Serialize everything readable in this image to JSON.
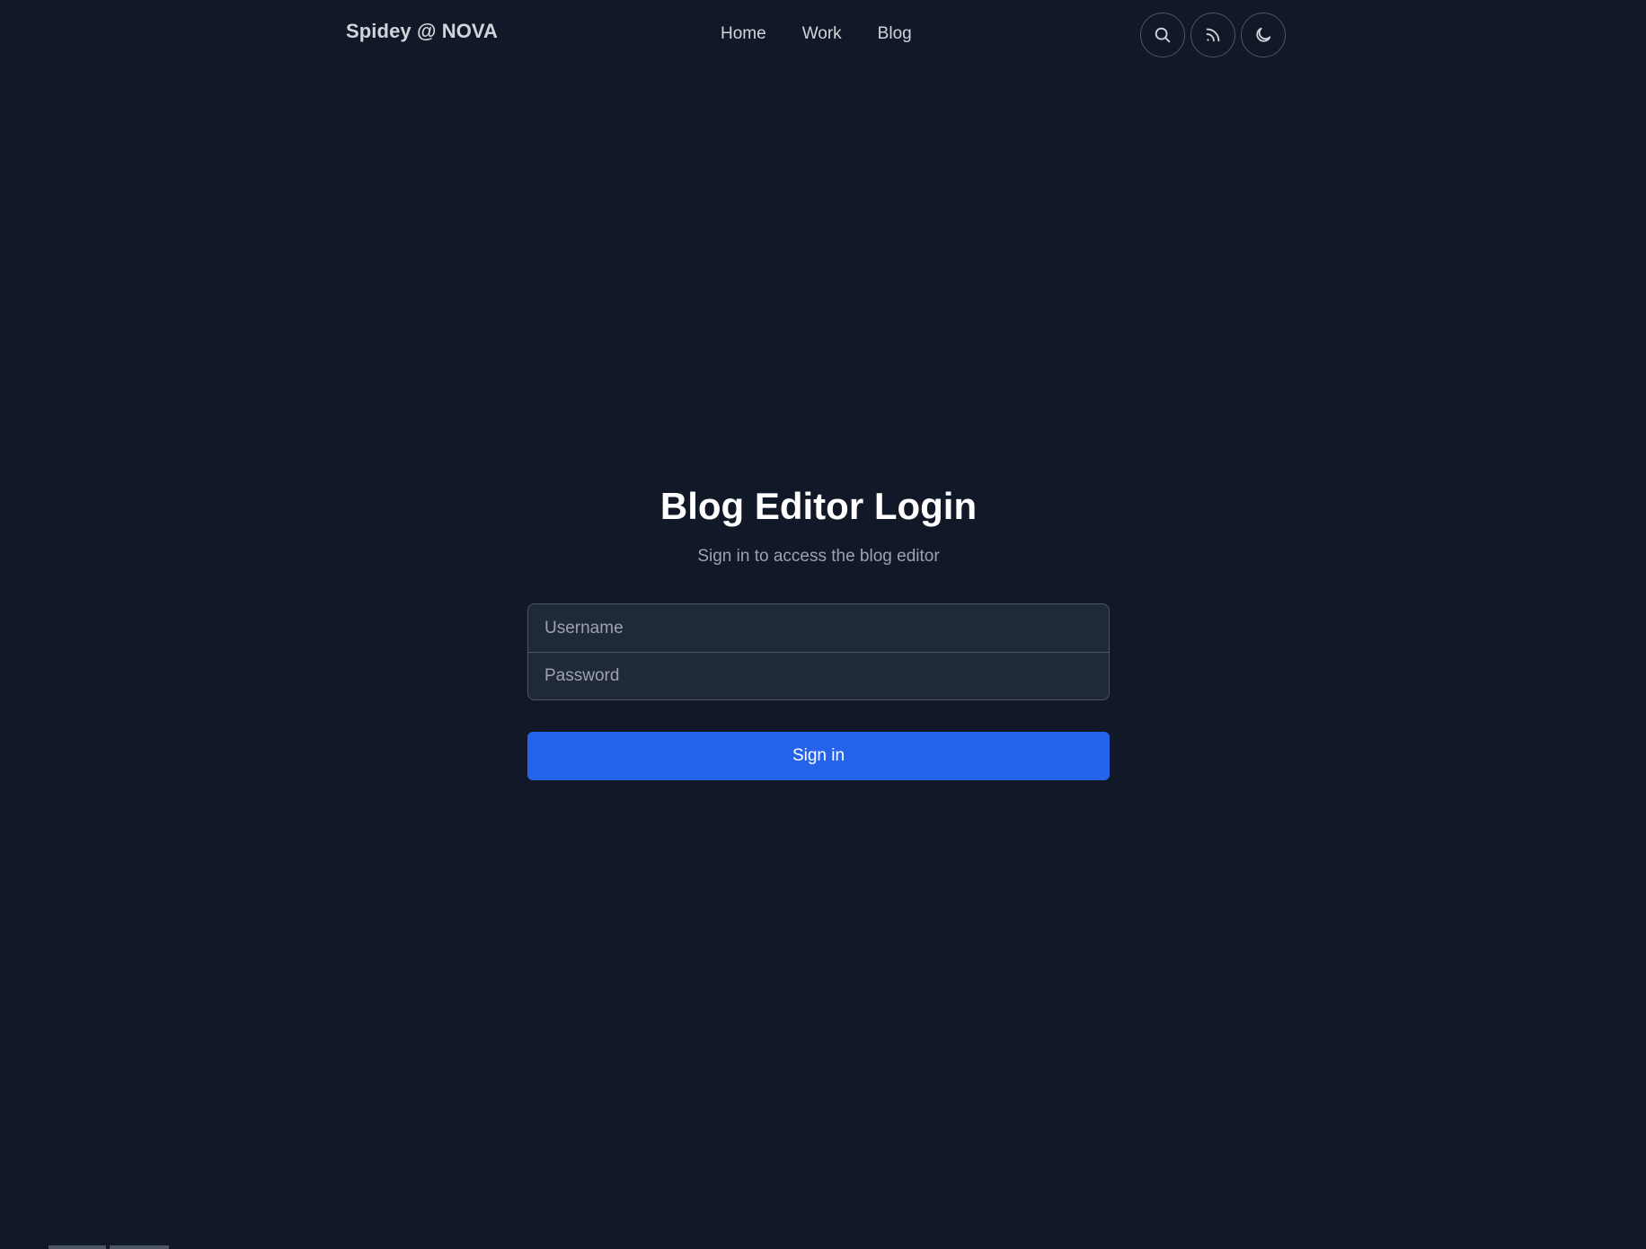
{
  "header": {
    "brand": "Spidey @ NOVA",
    "nav": [
      {
        "label": "Home"
      },
      {
        "label": "Work"
      },
      {
        "label": "Blog"
      }
    ],
    "icons": [
      "search-icon",
      "rss-icon",
      "moon-icon"
    ]
  },
  "login": {
    "title": "Blog Editor Login",
    "subtitle": "Sign in to access the blog editor",
    "username_placeholder": "Username",
    "password_placeholder": "Password",
    "button_label": "Sign in"
  },
  "colors": {
    "background": "#111827",
    "field_background": "#1f2937",
    "accent": "#2563eb",
    "border": "#4b5563"
  }
}
